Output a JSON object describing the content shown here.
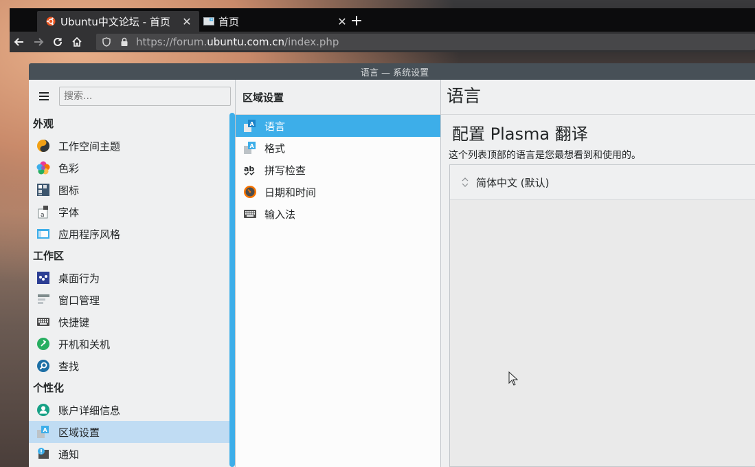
{
  "browser": {
    "tabs": [
      {
        "label": "Ubuntu中文论坛 - 首页",
        "active": true
      },
      {
        "label": "首页",
        "active": false
      }
    ],
    "url": {
      "prefix": "https://forum.",
      "domain": "ubuntu.com.cn",
      "path": "/index.php"
    }
  },
  "window": {
    "title": "语言 — 系统设置"
  },
  "sidebar": {
    "search_placeholder": "搜索...",
    "groups": [
      {
        "title": "外观",
        "items": [
          {
            "label": "工作空间主题",
            "icon": "workspace-theme-icon"
          },
          {
            "label": "色彩",
            "icon": "colors-icon"
          },
          {
            "label": "图标",
            "icon": "icons-icon"
          },
          {
            "label": "字体",
            "icon": "fonts-icon"
          },
          {
            "label": "应用程序风格",
            "icon": "app-style-icon"
          }
        ]
      },
      {
        "title": "工作区",
        "items": [
          {
            "label": "桌面行为",
            "icon": "desktop-behavior-icon"
          },
          {
            "label": "窗口管理",
            "icon": "window-management-icon"
          },
          {
            "label": "快捷键",
            "icon": "shortcuts-icon"
          },
          {
            "label": "开机和关机",
            "icon": "startup-shutdown-icon"
          },
          {
            "label": "查找",
            "icon": "search-icon"
          }
        ]
      },
      {
        "title": "个性化",
        "items": [
          {
            "label": "账户详细信息",
            "icon": "account-icon"
          },
          {
            "label": "区域设置",
            "icon": "regional-settings-icon",
            "selected": true
          },
          {
            "label": "通知",
            "icon": "notifications-icon"
          }
        ]
      }
    ]
  },
  "middle": {
    "title": "区域设置",
    "items": [
      {
        "label": "语言",
        "icon": "language-icon",
        "selected": true
      },
      {
        "label": "格式",
        "icon": "formats-icon"
      },
      {
        "label": "拼写检查",
        "icon": "spellcheck-icon"
      },
      {
        "label": "日期和时间",
        "icon": "date-time-icon"
      },
      {
        "label": "输入法",
        "icon": "input-method-icon"
      }
    ]
  },
  "content": {
    "page_title": "语言",
    "section_title": "配置 Plasma 翻译",
    "description": "这个列表顶部的语言是您最想看到和使用的。",
    "languages": [
      "简体中文 (默认)"
    ]
  },
  "colors": {
    "accent": "#3daee9",
    "selection_light": "#c0dcf3",
    "titlebar": "#475057"
  }
}
